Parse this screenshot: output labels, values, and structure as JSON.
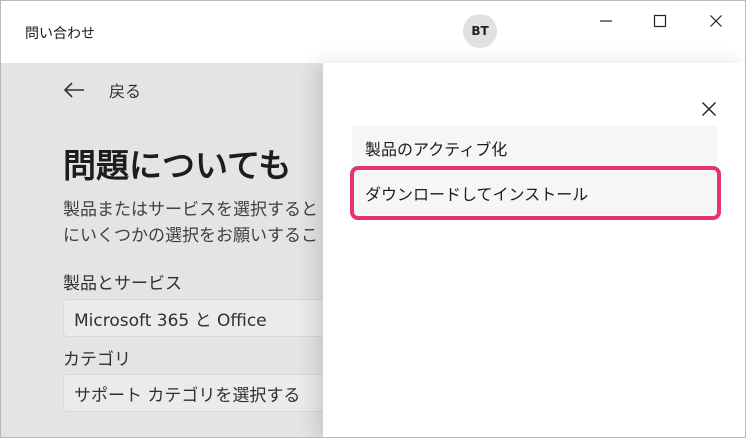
{
  "window": {
    "title": "問い合わせ",
    "avatar_initials": "BT"
  },
  "main": {
    "back_label": "戻る",
    "heading": "問題についても",
    "description_lines": [
      "製品またはサービスを選択すると",
      "にいくつかの選択をお願いするこ"
    ],
    "product_label": "製品とサービス",
    "product_value": "Microsoft 365 と Office",
    "category_label": "カテゴリ",
    "category_placeholder": "サポート カテゴリを選択する"
  },
  "panel": {
    "options": [
      "製品のアクティブ化",
      "ダウンロードしてインストール"
    ],
    "highlight_color": "#e8336b"
  }
}
